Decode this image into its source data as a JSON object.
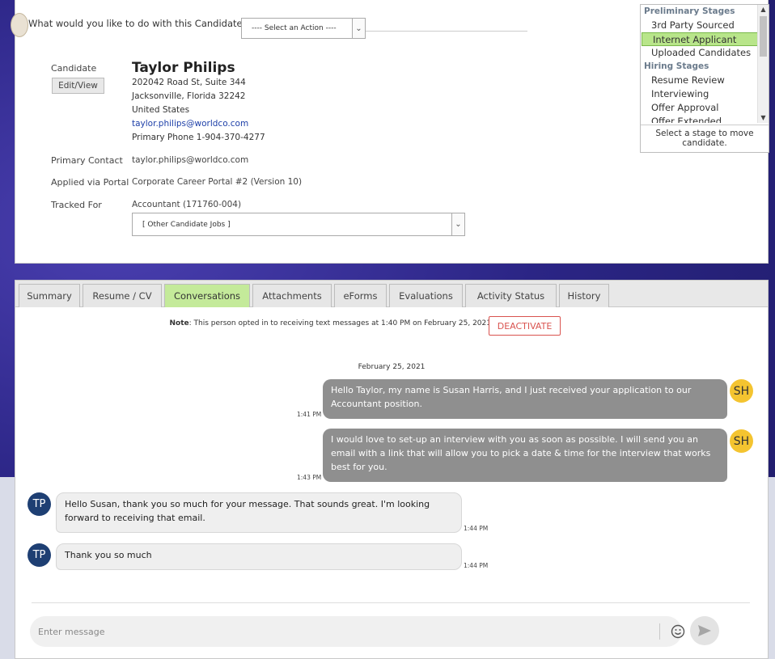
{
  "action_bar": {
    "question": "What would you like to do with this Candidate?",
    "select_value": "---- Select an Action ----"
  },
  "candidate": {
    "label": "Candidate",
    "edit_button": "Edit/View",
    "name": "Taylor Philips",
    "address_line1": "202042 Road St, Suite 344",
    "address_line2": "Jacksonville, Florida  32242",
    "country": "United States",
    "email": "taylor.philips@worldco.com",
    "phone": "Primary Phone 1-904-370-4277",
    "primary_contact_label": "Primary Contact",
    "primary_contact_value": "taylor.philips@worldco.com",
    "applied_label": "Applied via Portal",
    "applied_value": "Corporate Career Portal #2 (Version 10)",
    "tracked_label": "Tracked For",
    "tracked_value": "Accountant (171760-004)",
    "other_jobs_select": "[ Other Candidate Jobs ]"
  },
  "stages": {
    "groups": [
      {
        "heading": "Preliminary Stages",
        "items": [
          "3rd Party Sourced",
          "Internet Applicant",
          "Uploaded Candidates"
        ]
      },
      {
        "heading": "Hiring Stages",
        "items": [
          "Resume Review",
          "Interviewing",
          "Offer Approval",
          "Offer Extended"
        ]
      }
    ],
    "selected": "Internet Applicant",
    "hint": "Select a stage to move candidate."
  },
  "tabs": [
    "Summary",
    "Resume / CV",
    "Conversations",
    "Attachments",
    "eForms",
    "Evaluations",
    "Activity Status",
    "History"
  ],
  "active_tab": "Conversations",
  "note": {
    "prefix": "Note",
    "text": ": This person opted in to receiving text messages at 1:40 PM on February 25, 2021",
    "deactivate_button": "DEACTIVATE"
  },
  "conversation": {
    "date": "February 25, 2021",
    "messages": [
      {
        "from": "SH",
        "direction": "out",
        "time": "1:41 PM",
        "text": "Hello Taylor, my name is Susan Harris, and I just received your application to our Accountant position."
      },
      {
        "from": "SH",
        "direction": "out",
        "time": "1:43 PM",
        "text": "I would love to set-up an interview with you as soon as possible. I will send you an email with a link that will allow you to pick a date & time for the interview that works best for you."
      },
      {
        "from": "TP",
        "direction": "in",
        "time": "1:44 PM",
        "text": "Hello Susan, thank you so much for your message. That sounds great. I'm looking forward to receiving that email."
      },
      {
        "from": "TP",
        "direction": "in",
        "time": "1:44 PM",
        "text": "Thank you so much"
      }
    ]
  },
  "composer": {
    "placeholder": "Enter message"
  },
  "icons": {
    "dropdown": "chevron-down-icon",
    "emoji": "smiley-icon",
    "send": "send-arrow-icon"
  },
  "colors": {
    "active_tab": "#c4ea9a",
    "selected_stage": "#b8e58a",
    "deactivate": "#d9534f",
    "sender_avatar": "#f4c430",
    "candidate_avatar": "#1e3f73",
    "outgoing_bubble": "#8f8f8f",
    "link": "#1d3fa8"
  }
}
